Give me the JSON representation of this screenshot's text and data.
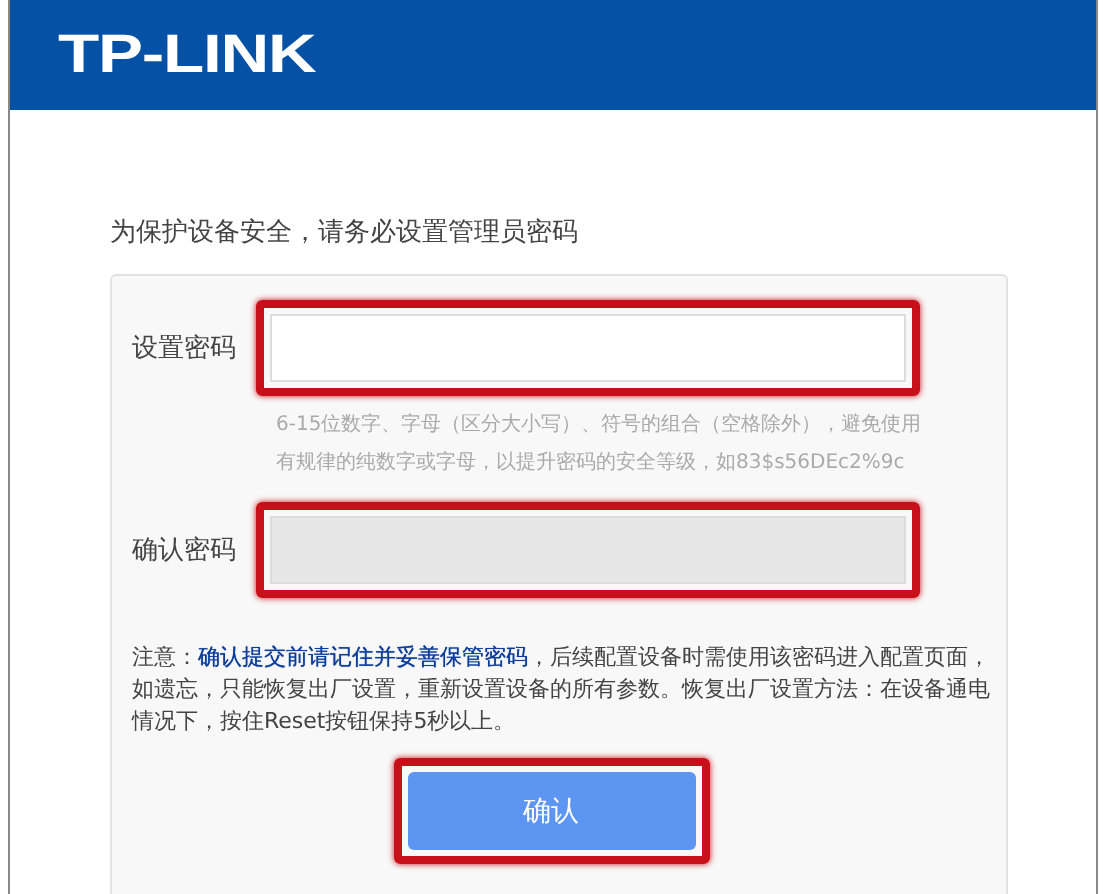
{
  "header": {
    "logo": "TP-LINK"
  },
  "prompt": "为保护设备安全，请务必设置管理员密码",
  "fields": [
    {
      "label": "设置密码",
      "disabled": false,
      "highlighted": true,
      "hint": "6-15位数字、字母（区分大小写）、符号的组合（空格除外），避免使用有规律的纯数字或字母，以提升密码的安全等级，如83$s56DEc2%9c"
    },
    {
      "label": "确认密码",
      "disabled": true,
      "highlighted": true
    }
  ],
  "note": "注意：**确认提交前请记住并妥善保管密码**，后续配置设备时需使用该密码进入配置页面，如遗忘，只能恢复出厂设置，重新设置设备的所有参数。恢复出厂设置方法：在设备通电情况下，按住Reset按钮保持5秒以上。",
  "button": {
    "label": "确认",
    "highlighted": true
  }
}
